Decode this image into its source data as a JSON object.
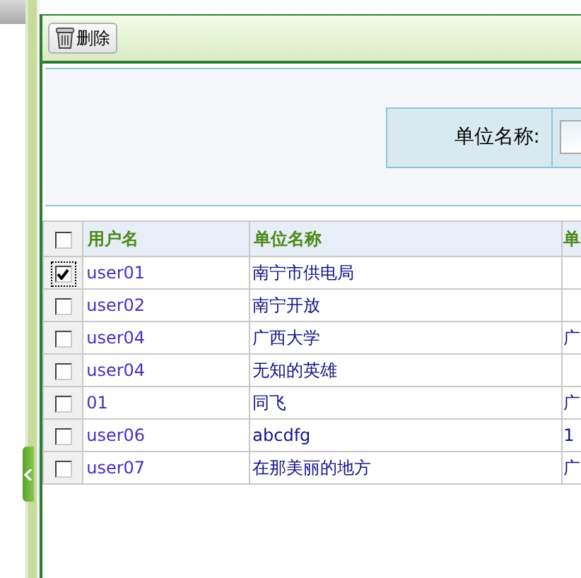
{
  "toolbar": {
    "delete_button": "删除"
  },
  "search": {
    "label": "单位名称:"
  },
  "table": {
    "columns": [
      "用户名",
      "单位名称",
      "单"
    ],
    "header_checked": false,
    "rows": [
      {
        "checked": true,
        "cells": [
          "user01",
          "南宁市供电局",
          ""
        ]
      },
      {
        "checked": false,
        "cells": [
          "user02",
          "南宁开放",
          ""
        ]
      },
      {
        "checked": false,
        "cells": [
          "user04",
          "广西大学",
          "广"
        ]
      },
      {
        "checked": false,
        "cells": [
          "user04",
          "无知的英雄",
          ""
        ]
      },
      {
        "checked": false,
        "cells": [
          "01",
          "同飞",
          "广"
        ]
      },
      {
        "checked": false,
        "cells": [
          "user06",
          "abcdfg",
          "1"
        ]
      },
      {
        "checked": false,
        "cells": [
          "user07",
          "在那美丽的地方",
          "广"
        ]
      }
    ]
  }
}
